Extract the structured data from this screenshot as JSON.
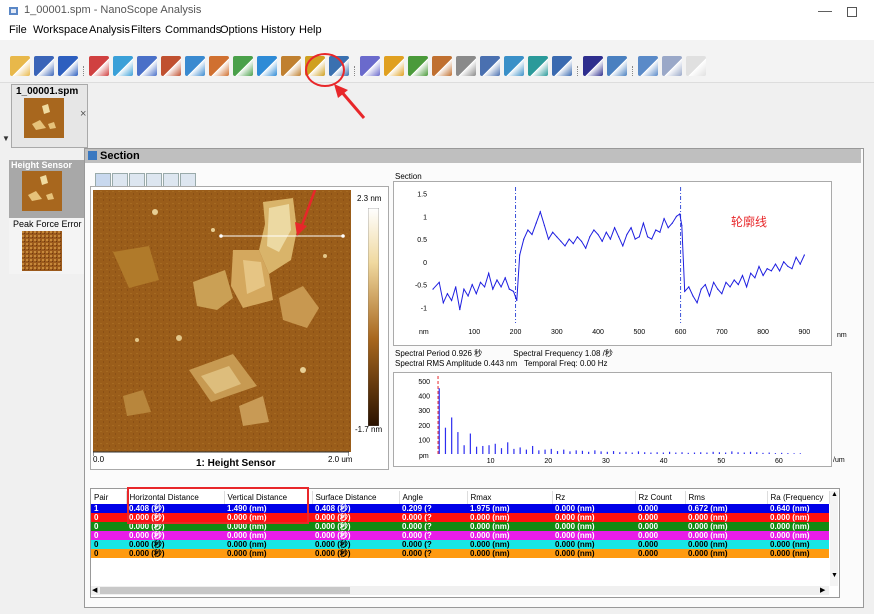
{
  "window": {
    "title": "1_00001.spm - NanoScope Analysis",
    "minimize": "—"
  },
  "menu": [
    "File",
    "Workspace",
    "Analysis",
    "Filters",
    "Commands",
    "Options",
    "History",
    "Help"
  ],
  "toolbar": {
    "icons": [
      "open-folder",
      "save",
      "help",
      "sep",
      "image-view",
      "plane-fit",
      "flatten",
      "section-tool",
      "surface-plot",
      "3d-view",
      "depth",
      "roughness",
      "bearing",
      "particle",
      "step",
      "sep",
      "angle",
      "histogram",
      "power-spectrum",
      "grain",
      "force",
      "force-volume",
      "indentation",
      "stats",
      "export",
      "sep",
      "layout",
      "window",
      "sep",
      "undo",
      "redo",
      "extra"
    ]
  },
  "file_tab": {
    "label": "1_00001.spm",
    "close": "×"
  },
  "channels": [
    {
      "label": "Height Sensor"
    },
    {
      "label": "Peak Force Error"
    }
  ],
  "section_panel": {
    "title": "Section"
  },
  "image_view": {
    "colorbar_max": "2.3 nm",
    "colorbar_min": "-1.7 nm",
    "scale_left": "0.0",
    "scale_name": "1: Height Sensor",
    "scale_right": "2.0 um"
  },
  "annotations": {
    "chinese_label": "轮廓线",
    "arrow_color": "#e8272a"
  },
  "plot_section": {
    "label": "Section",
    "y_unit": "nm",
    "x_unit": "nm"
  },
  "stats": {
    "line1_a": "Spectral Period 0.926 秒",
    "line1_b": "Spectral Frequency 1.08 /秒",
    "line2_a": "Spectral RMS Amplitude 0.443 nm",
    "line2_b": "Temporal Freq: 0.00 Hz"
  },
  "chart_data": [
    {
      "type": "line",
      "title": "Section",
      "xlabel": "nm",
      "ylabel": "nm",
      "xlim": [
        0,
        950
      ],
      "ylim": [
        -1.3,
        1.6
      ],
      "x_ticks": [
        100,
        200,
        300,
        400,
        500,
        600,
        700,
        800,
        900
      ],
      "y_ticks": [
        1.5,
        1,
        0.5,
        0,
        -0.5,
        -1
      ],
      "cursors_x": [
        200,
        600
      ],
      "annotation": "轮廓线",
      "series": [
        {
          "color": "#1f1fe0",
          "x": [
            0,
            15,
            25,
            35,
            45,
            55,
            65,
            75,
            85,
            95,
            105,
            115,
            125,
            135,
            145,
            155,
            165,
            175,
            185,
            195,
            203,
            210,
            220,
            230,
            240,
            250,
            260,
            270,
            280,
            290,
            300,
            310,
            320,
            330,
            340,
            350,
            360,
            370,
            380,
            390,
            400,
            410,
            420,
            430,
            440,
            450,
            460,
            470,
            480,
            490,
            500,
            510,
            520,
            530,
            540,
            550,
            560,
            570,
            580,
            590,
            598,
            603,
            610,
            620,
            630,
            640,
            650,
            660,
            670,
            680,
            690,
            700,
            710,
            720,
            730,
            740,
            750,
            760,
            770,
            780,
            790,
            800,
            810,
            820,
            830,
            840,
            850,
            860,
            870,
            880,
            890,
            900
          ],
          "y": [
            -0.6,
            -0.45,
            -0.9,
            -0.7,
            -0.85,
            -0.55,
            -1.05,
            -0.6,
            -0.75,
            -0.5,
            -0.7,
            -0.45,
            -0.55,
            -0.25,
            -0.6,
            -0.4,
            -0.55,
            -0.35,
            -0.6,
            -0.65,
            -0.85,
            0.15,
            0.5,
            0.7,
            0.6,
            0.85,
            1.1,
            0.8,
            0.5,
            0.65,
            0.55,
            0.45,
            0.35,
            0.5,
            0.4,
            0.55,
            0.45,
            0.3,
            0.55,
            0.7,
            0.6,
            0.45,
            0.65,
            0.5,
            0.75,
            0.55,
            0.35,
            0.6,
            0.75,
            0.5,
            0.55,
            0.85,
            0.55,
            0.5,
            0.7,
            0.65,
            0.95,
            0.75,
            0.85,
            1.0,
            1.05,
            0.8,
            -0.65,
            -0.55,
            -0.75,
            -0.9,
            -0.6,
            -0.5,
            -0.75,
            -0.45,
            -0.6,
            -0.7,
            -0.45,
            -0.55,
            -0.4,
            -0.5,
            -0.3,
            -0.55,
            -0.25,
            -0.35,
            -0.1,
            -0.3,
            -0.15,
            -0.2,
            -0.05,
            -0.2,
            0.0,
            -0.1,
            -0.15,
            0.1,
            -0.05,
            0.15
          ]
        }
      ]
    },
    {
      "type": "bar",
      "title": "",
      "xlabel": "/um",
      "ylabel": "pm",
      "xlim": [
        0,
        68
      ],
      "ylim": [
        0,
        520
      ],
      "x_ticks": [
        10,
        20,
        30,
        40,
        50,
        60
      ],
      "y_ticks": [
        500,
        400,
        300,
        200,
        100
      ],
      "cursor_x": 1.08,
      "series": [
        {
          "color": "#2d2df0",
          "x": [
            1.08,
            2.16,
            3.24,
            4.32,
            5.4,
            6.48,
            7.56,
            8.64,
            9.72,
            10.8,
            11.88,
            12.96,
            14.04,
            15.12,
            16.2,
            17.28,
            18.36,
            19.44,
            20.52,
            21.6,
            22.68,
            23.76,
            24.84,
            25.92,
            27.0,
            28.08,
            29.16,
            30.24,
            31.32,
            32.4,
            33.48,
            34.56,
            35.64,
            36.72,
            37.8,
            38.88,
            39.96,
            41.04,
            42.12,
            43.2,
            44.28,
            45.36,
            46.44,
            47.52,
            48.6,
            49.68,
            50.76,
            51.84,
            52.92,
            54.0,
            55.08,
            56.16,
            57.24,
            58.32,
            59.4,
            60.48,
            61.56,
            62.64,
            63.72
          ],
          "y": [
            450,
            180,
            250,
            150,
            60,
            140,
            50,
            55,
            60,
            70,
            40,
            80,
            35,
            45,
            30,
            55,
            25,
            30,
            35,
            20,
            30,
            18,
            25,
            22,
            15,
            25,
            18,
            15,
            20,
            12,
            15,
            10,
            18,
            12,
            10,
            12,
            10,
            15,
            10,
            12,
            8,
            10,
            12,
            10,
            15,
            12,
            10,
            18,
            12,
            10,
            15,
            12,
            8,
            10,
            6,
            8,
            6,
            5,
            5
          ]
        }
      ]
    }
  ],
  "table": {
    "headers": [
      "Pair",
      "Horizontal Distance",
      "Vertical Distance",
      "Surface Distance",
      "Angle",
      "Rmax",
      "Rz",
      "Rz Count",
      "Rms",
      "Ra (Frequency"
    ],
    "rows": [
      {
        "bg": "#0000e8",
        "fg": "#ffffff",
        "cells": [
          "1",
          "0.408 (秒)",
          "1.490 (nm)",
          "0.408 (秒)",
          "0.209 (?",
          "1.975 (nm)",
          "0.000 (nm)",
          "0.000",
          "0.672 (nm)",
          "0.640 (nm)"
        ]
      },
      {
        "bg": "#ff1010",
        "fg": "#ffffff",
        "cells": [
          "0",
          "0.000 (秒)",
          "0.000 (nm)",
          "0.000 (秒)",
          "0.000 (?",
          "0.000 (nm)",
          "0.000 (nm)",
          "0.000",
          "0.000 (nm)",
          "0.000 (nm)"
        ]
      },
      {
        "bg": "#128a12",
        "fg": "#ffffff",
        "cells": [
          "0",
          "0.000 (秒)",
          "0.000 (nm)",
          "0.000 (秒)",
          "0.000 (?",
          "0.000 (nm)",
          "0.000 (nm)",
          "0.000",
          "0.000 (nm)",
          "0.000 (nm)"
        ]
      },
      {
        "bg": "#e81ce8",
        "fg": "#ffffff",
        "cells": [
          "0",
          "0.000 (秒)",
          "0.000 (nm)",
          "0.000 (秒)",
          "0.000 (?",
          "0.000 (nm)",
          "0.000 (nm)",
          "0.000",
          "0.000 (nm)",
          "0.000 (nm)"
        ]
      },
      {
        "bg": "#18e6e6",
        "fg": "#000000",
        "cells": [
          "0",
          "0.000 (秒)",
          "0.000 (nm)",
          "0.000 (秒)",
          "0.000 (?",
          "0.000 (nm)",
          "0.000 (nm)",
          "0.000",
          "0.000 (nm)",
          "0.000 (nm)"
        ]
      },
      {
        "bg": "#ff9a10",
        "fg": "#000000",
        "cells": [
          "0",
          "0.000 (秒)",
          "0.000 (nm)",
          "0.000 (秒)",
          "0.000 (?",
          "0.000 (nm)",
          "0.000 (nm)",
          "0.000",
          "0.000 (nm)",
          "0.000 (nm)"
        ]
      }
    ]
  }
}
